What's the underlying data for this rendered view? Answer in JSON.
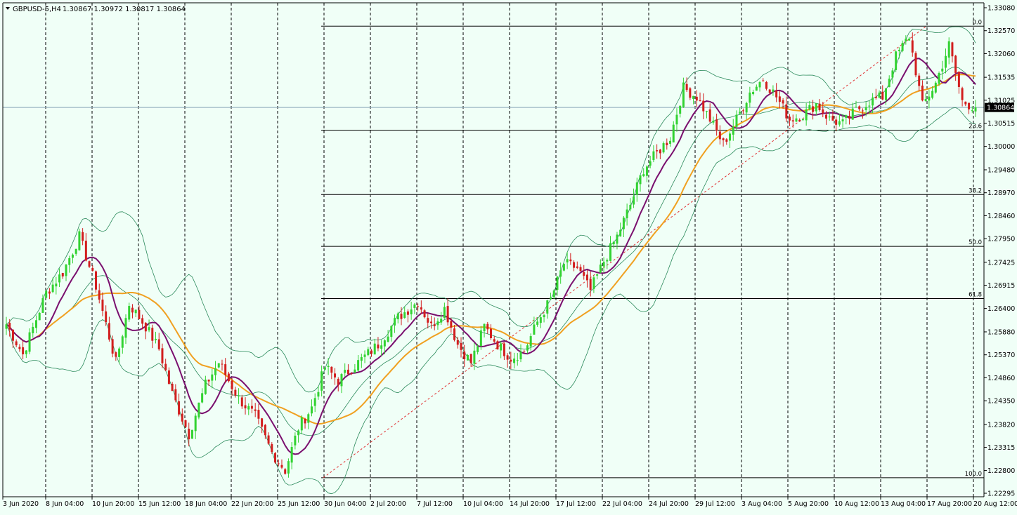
{
  "header": {
    "symbol": "GBPUSD-5,H4",
    "ohlc": "1.30867 1.30972 1.30817 1.30864"
  },
  "price_label": "1.30864",
  "colors": {
    "background": "#f0fff7",
    "bull": "#32d232",
    "bear": "#d21e1e",
    "ma_fast": "#7a0f6e",
    "ma_slow": "#f0a020",
    "bands": "#2a8a5a",
    "grid": "#000000",
    "fib": "#000000",
    "trend": "#e03030",
    "current_price_line": "#8aa6b8"
  },
  "chart_data": {
    "type": "candlestick",
    "y_axis": {
      "min": 1.22295,
      "max": 1.3308,
      "ticks": [
        "1.33080",
        "1.32570",
        "1.32060",
        "1.31535",
        "1.31025",
        "1.30515",
        "1.30000",
        "1.29480",
        "1.28970",
        "1.28460",
        "1.27950",
        "1.27425",
        "1.26915",
        "1.26400",
        "1.25880",
        "1.25370",
        "1.24860",
        "1.24350",
        "1.23820",
        "1.23315",
        "1.22800",
        "1.22295"
      ]
    },
    "x_axis": {
      "labels": [
        "3 Jun 2020",
        "8 Jun 04:00",
        "10 Jun 20:00",
        "15 Jun 12:00",
        "18 Jun 04:00",
        "22 Jun 20:00",
        "25 Jun 12:00",
        "30 Jun 04:00",
        "2 Jul 20:00",
        "7 Jul 12:00",
        "10 Jul 04:00",
        "14 Jul 20:00",
        "17 Jul 12:00",
        "22 Jul 04:00",
        "24 Jul 20:00",
        "29 Jul 12:00",
        "3 Aug 04:00",
        "5 Aug 20:00",
        "10 Aug 12:00",
        "13 Aug 04:00",
        "17 Aug 20:00",
        "20 Aug 12:00"
      ]
    },
    "fibonacci": {
      "levels": [
        {
          "label": "0.0",
          "price": 1.3267
        },
        {
          "label": "23.6",
          "price": 1.3036
        },
        {
          "label": "38.2",
          "price": 1.2893
        },
        {
          "label": "50.0",
          "price": 1.2778
        },
        {
          "label": "61.8",
          "price": 1.2662
        },
        {
          "label": "100.0",
          "price": 1.2264
        }
      ]
    },
    "current_price": 1.30864,
    "path_anchors": [
      [
        0,
        1.2605
      ],
      [
        5,
        1.2538
      ],
      [
        12,
        1.2675
      ],
      [
        17,
        1.272
      ],
      [
        22,
        1.28
      ],
      [
        27,
        1.269
      ],
      [
        33,
        1.252
      ],
      [
        37,
        1.265
      ],
      [
        42,
        1.26
      ],
      [
        46,
        1.255
      ],
      [
        50,
        1.245
      ],
      [
        55,
        1.236
      ],
      [
        60,
        1.247
      ],
      [
        64,
        1.252
      ],
      [
        70,
        1.244
      ],
      [
        75,
        1.24
      ],
      [
        80,
        1.232
      ],
      [
        84,
        1.228
      ],
      [
        88,
        1.2375
      ],
      [
        92,
        1.242
      ],
      [
        96,
        1.251
      ],
      [
        100,
        1.248
      ],
      [
        106,
        1.252
      ],
      [
        112,
        1.256
      ],
      [
        118,
        1.262
      ],
      [
        124,
        1.2655
      ],
      [
        128,
        1.26
      ],
      [
        132,
        1.264
      ],
      [
        136,
        1.256
      ],
      [
        140,
        1.252
      ],
      [
        144,
        1.26
      ],
      [
        148,
        1.256
      ],
      [
        152,
        1.253
      ],
      [
        156,
        1.2545
      ],
      [
        160,
        1.261
      ],
      [
        164,
        1.266
      ],
      [
        168,
        1.274
      ],
      [
        172,
        1.273
      ],
      [
        176,
        1.268
      ],
      [
        180,
        1.2745
      ],
      [
        184,
        1.28
      ],
      [
        188,
        1.287
      ],
      [
        192,
        1.295
      ],
      [
        196,
        1.2985
      ],
      [
        200,
        1.302
      ],
      [
        204,
        1.313
      ],
      [
        208,
        1.311
      ],
      [
        212,
        1.306
      ],
      [
        216,
        1.3005
      ],
      [
        220,
        1.306
      ],
      [
        224,
        1.312
      ],
      [
        228,
        1.315
      ],
      [
        232,
        1.311
      ],
      [
        236,
        1.306
      ],
      [
        240,
        1.307
      ],
      [
        244,
        1.3095
      ],
      [
        248,
        1.306
      ],
      [
        252,
        1.305
      ],
      [
        256,
        1.308
      ],
      [
        260,
        1.31
      ],
      [
        264,
        1.311
      ],
      [
        268,
        1.32
      ],
      [
        272,
        1.3245
      ],
      [
        276,
        1.309
      ],
      [
        280,
        1.314
      ],
      [
        284,
        1.3225
      ],
      [
        288,
        1.31
      ],
      [
        292,
        1.3086
      ]
    ]
  }
}
